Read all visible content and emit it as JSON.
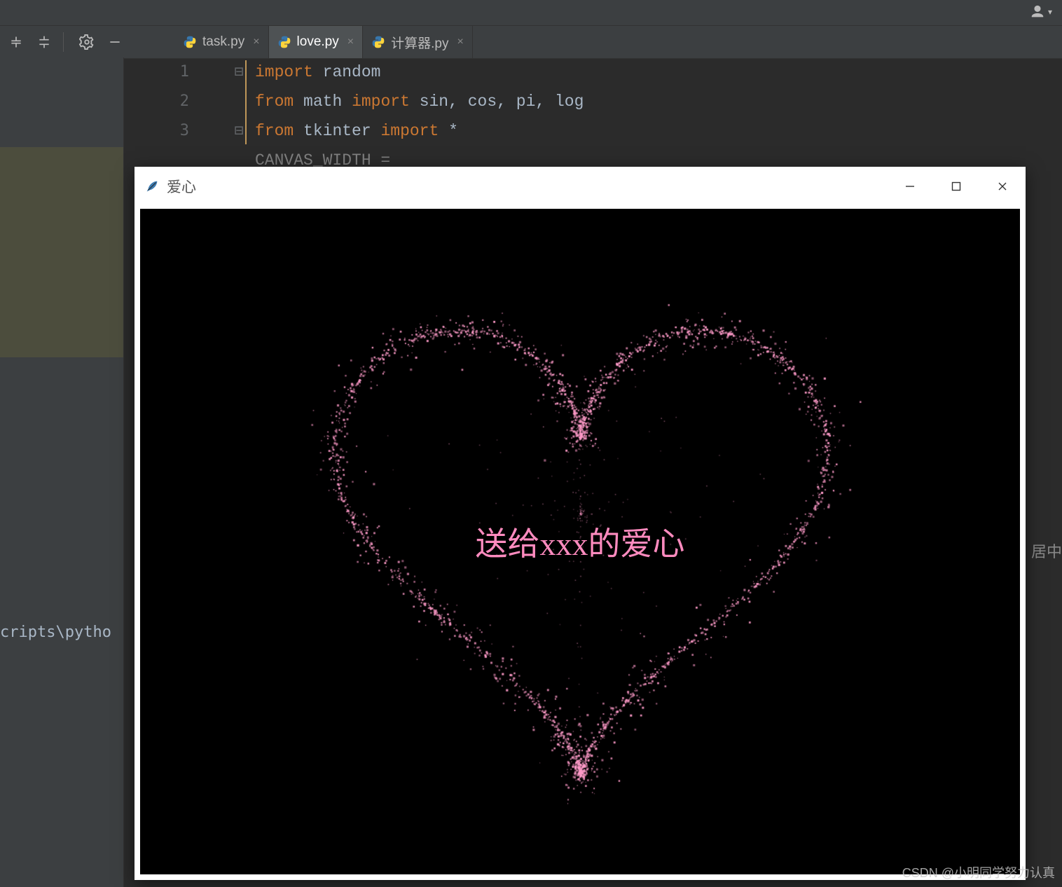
{
  "toolbar": {
    "tabs": [
      {
        "label": "task.py"
      },
      {
        "label": "love.py"
      },
      {
        "label": "计算器.py"
      }
    ]
  },
  "editor": {
    "lines": [
      "1",
      "2",
      "3"
    ],
    "fold": [
      "⊟",
      " ",
      "⊟"
    ],
    "code_tokens": [
      [
        [
          "kw",
          "import"
        ],
        [
          "op",
          " "
        ],
        [
          "id",
          "random"
        ]
      ],
      [
        [
          "kw",
          "from"
        ],
        [
          "op",
          " "
        ],
        [
          "id",
          "math"
        ],
        [
          "op",
          " "
        ],
        [
          "kw",
          "import"
        ],
        [
          "op",
          " "
        ],
        [
          "id",
          "sin"
        ],
        [
          "op",
          ", "
        ],
        [
          "id",
          "cos"
        ],
        [
          "op",
          ", "
        ],
        [
          "id",
          "pi"
        ],
        [
          "op",
          ", "
        ],
        [
          "id",
          "log"
        ]
      ],
      [
        [
          "kw",
          "from"
        ],
        [
          "op",
          " "
        ],
        [
          "id",
          "tkinter"
        ],
        [
          "op",
          " "
        ],
        [
          "kw",
          "import"
        ],
        [
          "op",
          " "
        ],
        [
          "op",
          "*"
        ]
      ]
    ],
    "partial_line4": "CANVAS_WIDTH = "
  },
  "terminal": {
    "path_fragment": "cripts\\pytho"
  },
  "right_hint": "居中",
  "tk": {
    "title": "爱心",
    "heart_text": "送给xxx的爱心",
    "heart_color": "#ff9bc9",
    "heart_points": 2600
  },
  "watermark": "CSDN @小明同学努力认真"
}
